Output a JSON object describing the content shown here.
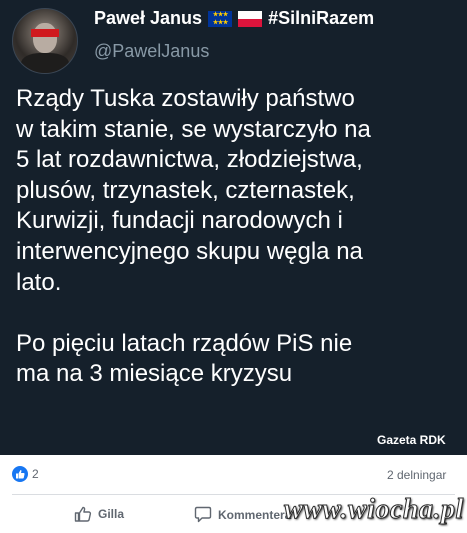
{
  "tweet": {
    "author_name": "Paweł Janus",
    "hashtag": "#SilniRazem",
    "handle": "@PawelJanus",
    "text": "Rządy Tuska zostawiły państwo\nw takim stanie, se wystarczyło na\n5 lat  rozdawnictwa, złodziejstwa,\nplusów, trzynastek, czternastek,\nKurwizji, fundacji narodowych i\ninterwencyjnego skupu węgla na\nlato.\n\nPo pięciu latach rządów PiS nie\nma na 3 miesiące kryzysu",
    "watermark": "Gazeta RDK"
  },
  "post": {
    "reaction_count": "2",
    "shares": "2 delningar",
    "like_label": "Gilla",
    "comment_label": "Kommentera"
  },
  "site_watermark": "www.wiocha.pl",
  "colors": {
    "tweet_bg": "#15202b",
    "like_blue": "#1877f2",
    "muted": "#606770"
  }
}
